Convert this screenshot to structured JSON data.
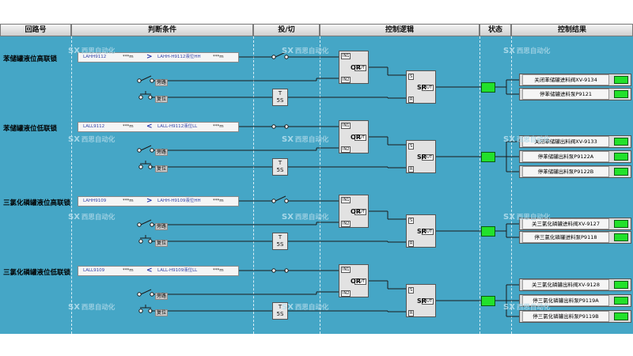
{
  "headers": {
    "loop": "回路号",
    "condition": "判断条件",
    "toggle": "投/切",
    "logic": "控制逻辑",
    "state": "状态",
    "result": "控制结果"
  },
  "watermark": {
    "mark": "SX",
    "text": "西思自动化"
  },
  "common": {
    "bypass": "旁路",
    "reset": "复位",
    "timer_prefix": "T",
    "timer_value": "5S",
    "or_gate": "OR",
    "sr_gate": "SR",
    "pin_in1": "IN1",
    "pin_in2": "IN2",
    "pin_out": "OUT",
    "pin_s": "S",
    "pin_r": "R",
    "star_value": "***m"
  },
  "loops": [
    {
      "title": "苯储罐液位高联锁",
      "tag": "LAHH9112",
      "operator": ">",
      "limit_label": "LAHH-H9112液位HH",
      "results": [
        "关闭苯储罐进料阀XV-9134",
        "停苯储罐进料泵P9121"
      ]
    },
    {
      "title": "苯储罐液位低联锁",
      "tag": "LALL9112",
      "operator": "<",
      "limit_label": "LALL-H9112液位LL",
      "results": [
        "关闭苯储罐出料阀XV-9133",
        "停苯储罐出料泵P9122A",
        "停苯储罐出料泵P9122B"
      ]
    },
    {
      "title": "三氯化磷罐液位高联锁",
      "tag": "LAHH9109",
      "operator": ">",
      "limit_label": "LAHH-H9109液位HH",
      "results": [
        "关三氯化磷罐进料阀XV-9127",
        "停三氯化磷罐进料泵P9118"
      ]
    },
    {
      "title": "三氯化磷罐液位低联锁",
      "tag": "LALL9109",
      "operator": "<",
      "limit_label": "LALL-H9109液位LL",
      "results": [
        "关三氯化磷罐出料阀XV-9128",
        "停三氯化磷罐出料泵P9119A",
        "停三氯化磷罐出料泵P9119B"
      ]
    }
  ]
}
